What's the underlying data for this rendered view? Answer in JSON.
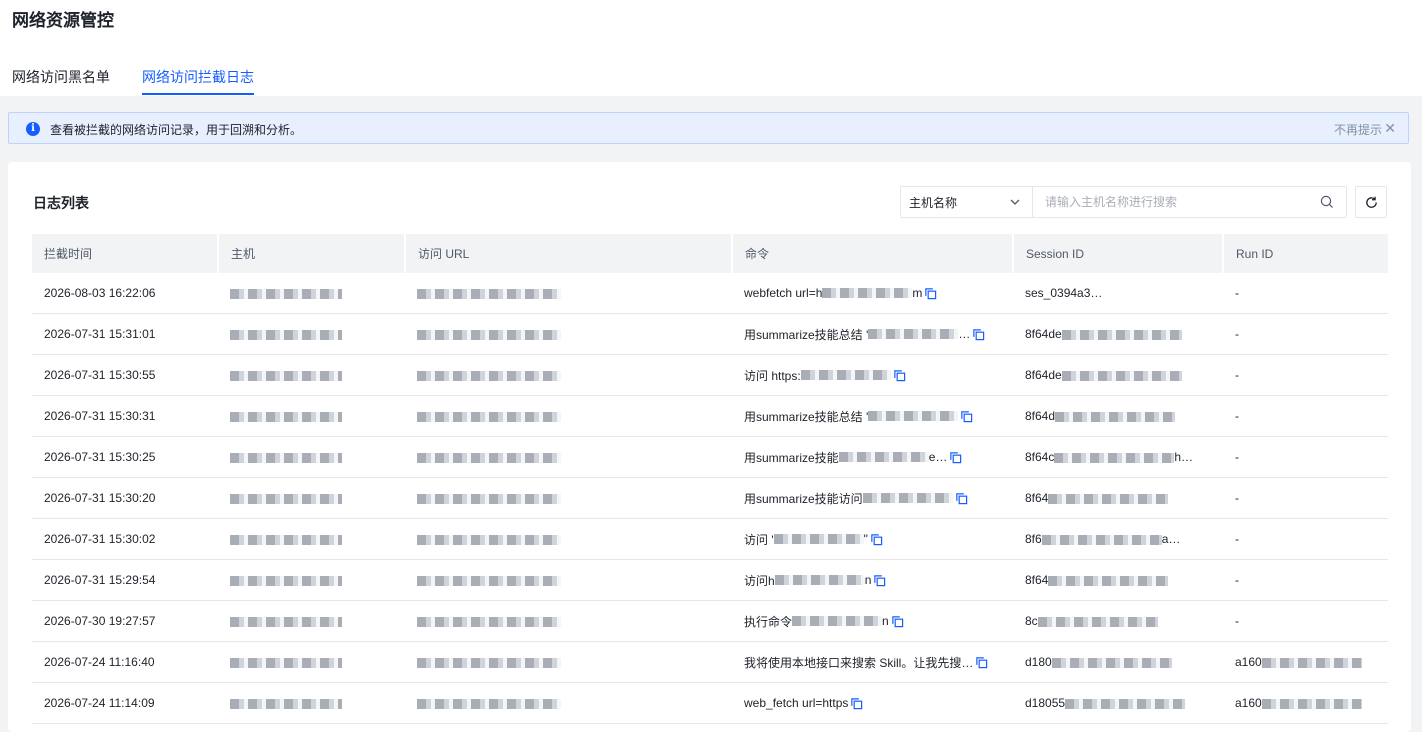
{
  "page_title": "网络资源管控",
  "tabs": [
    {
      "label": "网络访问黑名单",
      "active": false
    },
    {
      "label": "网络访问拦截日志",
      "active": true
    }
  ],
  "notice": {
    "text": "查看被拦截的网络访问记录，用于回溯和分析。",
    "dismiss_label": "不再提示"
  },
  "card": {
    "title": "日志列表",
    "search": {
      "field_value": "主机名称",
      "placeholder": "请输入主机名称进行搜索"
    }
  },
  "table": {
    "columns": [
      "拦截时间",
      "主机",
      "访问 URL",
      "命令",
      "Session ID",
      "Run ID"
    ],
    "rows": [
      {
        "time": "2026-08-03 16:22:06",
        "command": "webfetch url=h",
        "command_tail": "m",
        "session": "ses_0394a3",
        "session_tail": "…",
        "run": "-"
      },
      {
        "time": "2026-07-31 15:31:01",
        "command": "用summarize技能总结 '",
        "command_tail": "…",
        "session": "8f64de",
        "session_tail": "",
        "run": "-"
      },
      {
        "time": "2026-07-31 15:30:55",
        "command": "访问 https:",
        "command_tail": "",
        "session": "8f64de",
        "session_tail": "",
        "run": "-"
      },
      {
        "time": "2026-07-31 15:30:31",
        "command": "用summarize技能总结 '",
        "command_tail": "",
        "session": "8f64d",
        "session_tail": "",
        "run": "-"
      },
      {
        "time": "2026-07-31 15:30:25",
        "command": "用summarize技能",
        "command_tail": "e…",
        "session": "8f64c",
        "session_tail": "h…",
        "run": "-"
      },
      {
        "time": "2026-07-31 15:30:20",
        "command": "用summarize技能访问",
        "command_tail": "",
        "session": "8f64",
        "session_tail": "",
        "run": "-"
      },
      {
        "time": "2026-07-31 15:30:02",
        "command": "访问 '",
        "command_tail": "\"",
        "session": "8f6",
        "session_tail": "a…",
        "run": "-"
      },
      {
        "time": "2026-07-31 15:29:54",
        "command": "访问h",
        "command_tail": "n",
        "session": "8f64",
        "session_tail": "",
        "run": "-"
      },
      {
        "time": "2026-07-30 19:27:57",
        "command": "执行命令",
        "command_tail": "n",
        "session": "8c",
        "session_tail": "",
        "run": "-"
      },
      {
        "time": "2026-07-24 11:16:40",
        "command": "我将使用本地接口来搜索 Skill。让我先搜…",
        "command_tail": "",
        "session": "d180",
        "session_tail": "",
        "run": "a160"
      },
      {
        "time": "2026-07-24 11:14:09",
        "command": "web_fetch url=https",
        "command_tail": "",
        "session": "d18055",
        "session_tail": "",
        "run": "a160"
      }
    ]
  },
  "colors": {
    "accent": "#165dff",
    "notice_bg": "#e8f0ff",
    "header_bg": "#f2f3f5",
    "redacted": "#b8bcc4"
  },
  "icons": [
    "info-icon",
    "close-icon",
    "chevron-down-icon",
    "search-icon",
    "refresh-icon",
    "copy-icon"
  ]
}
